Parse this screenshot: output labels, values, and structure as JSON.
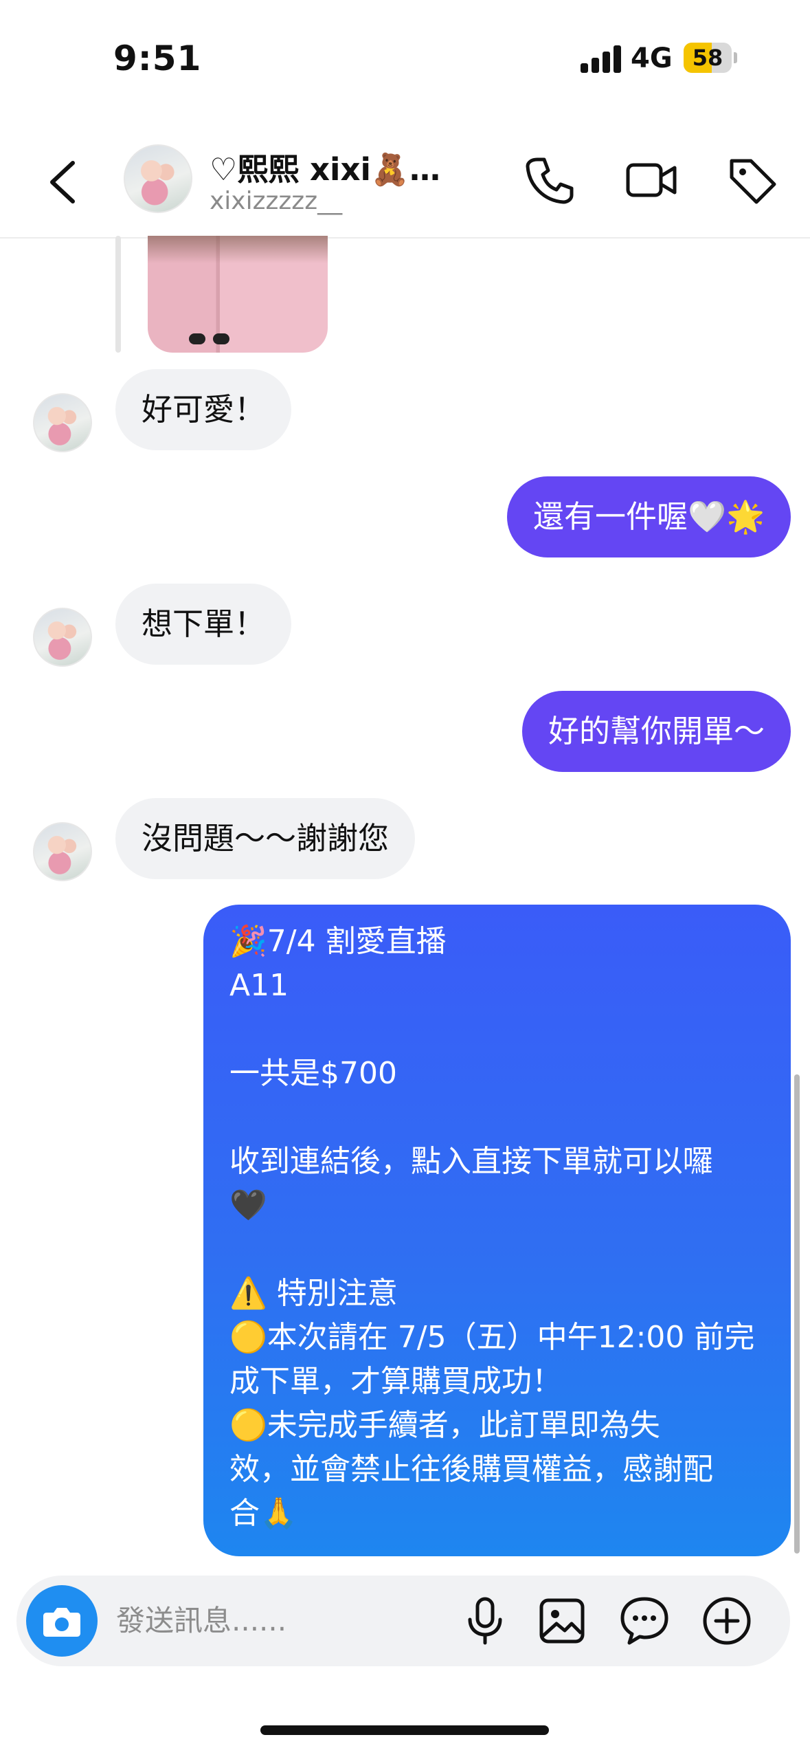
{
  "status_bar": {
    "time": "9:51",
    "network": "4G",
    "battery": "58"
  },
  "header": {
    "name": "♡熙熙 xixi🧸…",
    "handle": "xixizzzzz__",
    "icons": [
      "back-icon",
      "phone-icon",
      "video-icon",
      "tag-icon"
    ]
  },
  "messages": [
    {
      "side": "in",
      "text": "好可愛！"
    },
    {
      "side": "out",
      "text": "還有一件喔🤍🌟"
    },
    {
      "side": "in",
      "text": "想下單！"
    },
    {
      "side": "out",
      "text": "好的幫你開單～"
    },
    {
      "side": "in",
      "text": "沒問題～～謝謝您"
    }
  ],
  "order_message": {
    "lines": [
      "🎉7/4 割愛直播",
      "A11",
      "",
      "一共是$700",
      "",
      "收到連結後，點入直接下單就可以囉",
      "🖤",
      "",
      "⚠️ 特別注意",
      "🟡本次請在 7/5（五）中午12:00 前完",
      "成下單，才算購買成功！",
      "🟡未完成手續者，此訂單即為失",
      "效，並會禁止往後購買權益，感謝配",
      "合🙏"
    ]
  },
  "composer": {
    "placeholder": "發送訊息......",
    "icons": [
      "camera-icon",
      "microphone-icon",
      "image-icon",
      "sticker-icon",
      "plus-icon"
    ]
  },
  "colors": {
    "outgoing": "#6446f3",
    "order_top": "#3a5cf8",
    "order_bottom": "#1e86f0",
    "incoming": "#f1f2f4",
    "camera": "#1f8ef1"
  }
}
